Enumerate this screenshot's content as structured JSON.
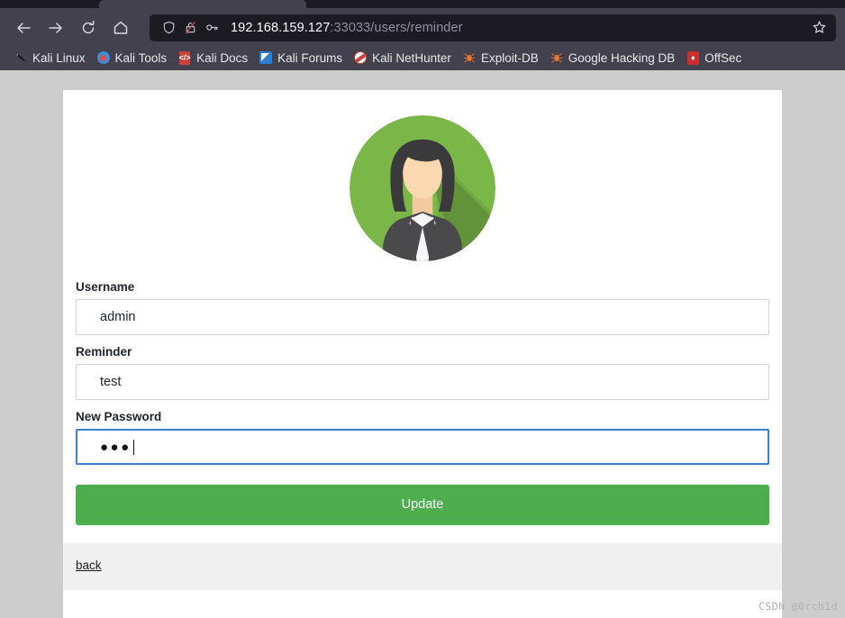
{
  "browser": {
    "nav": {
      "back_label": "Back",
      "forward_label": "Forward",
      "reload_label": "Reload",
      "home_label": "Home"
    },
    "url": {
      "host": "192.168.159.127",
      "rest": ":33033/users/reminder",
      "full": "192.168.159.127:33033/users/reminder",
      "shield_icon": "shield-icon",
      "lock_broken_icon": "lock-broken-icon",
      "key_icon": "key-icon",
      "bookmark_star_icon": "star-icon"
    },
    "bookmarks": [
      {
        "label": "Kali Linux",
        "icon": "kali-dragon-icon"
      },
      {
        "label": "Kali Tools",
        "icon": "kali-tools-icon"
      },
      {
        "label": "Kali Docs",
        "icon": "kali-docs-icon"
      },
      {
        "label": "Kali Forums",
        "icon": "kali-forums-icon"
      },
      {
        "label": "Kali NetHunter",
        "icon": "kali-nethunter-icon"
      },
      {
        "label": "Exploit-DB",
        "icon": "exploit-db-icon"
      },
      {
        "label": "Google Hacking DB",
        "icon": "google-hacking-db-icon"
      },
      {
        "label": "OffSec",
        "icon": "offsec-icon"
      }
    ]
  },
  "page": {
    "avatar_icon": "user-avatar-icon",
    "fields": [
      {
        "label": "Username",
        "value": "admin",
        "type": "text",
        "focused": false,
        "name": "username"
      },
      {
        "label": "Reminder",
        "value": "test",
        "type": "text",
        "focused": false,
        "name": "reminder"
      },
      {
        "label": "New Password",
        "value": "●●●",
        "type": "password",
        "focused": true,
        "name": "new-password"
      }
    ],
    "submit_label": "Update",
    "back_label": "back",
    "colors": {
      "button_green": "#4cae4c",
      "avatar_green": "#7ab648",
      "focus_blue": "#3b82d6",
      "page_background": "#cdcdcd",
      "footer_background": "#f0f0f0"
    }
  },
  "watermark": {
    "text": "CSDN @0rch1d"
  }
}
